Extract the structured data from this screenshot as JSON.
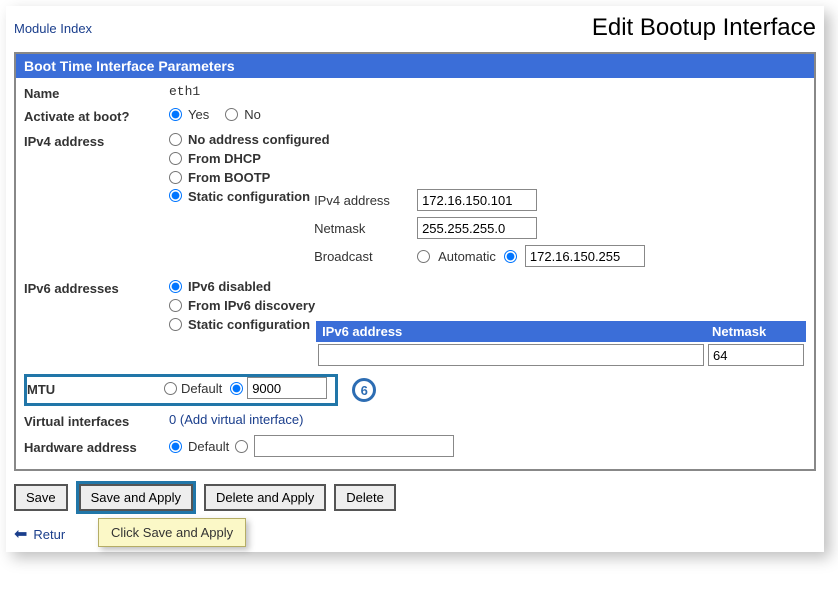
{
  "header": {
    "module_index_link": "Module Index",
    "page_title": "Edit Bootup Interface"
  },
  "panel": {
    "title": "Boot Time Interface Parameters",
    "name": {
      "label": "Name",
      "value": "eth1"
    },
    "activate": {
      "label": "Activate at boot?",
      "yes": "Yes",
      "no": "No"
    },
    "ipv4": {
      "label": "IPv4 address",
      "none": "No address configured",
      "dhcp": "From DHCP",
      "bootp": "From BOOTP",
      "static": "Static configuration",
      "addr_label": "IPv4 address",
      "addr_value": "172.16.150.101",
      "netmask_label": "Netmask",
      "netmask_value": "255.255.255.0",
      "broadcast_label": "Broadcast",
      "broadcast_auto": "Automatic",
      "broadcast_value": "172.16.150.255"
    },
    "ipv6": {
      "label": "IPv6 addresses",
      "disabled": "IPv6 disabled",
      "discovery": "From IPv6 discovery",
      "static": "Static configuration",
      "addr_header": "IPv6 address",
      "netmask_header": "Netmask",
      "addr_value": "",
      "netmask_value": "64"
    },
    "mtu": {
      "label": "MTU",
      "default": "Default",
      "value": "9000",
      "callout": "6"
    },
    "vifs": {
      "label": "Virtual interfaces",
      "count": "0",
      "add_link": "Add virtual interface"
    },
    "hw": {
      "label": "Hardware address",
      "default": "Default",
      "value": ""
    }
  },
  "buttons": {
    "save": "Save",
    "save_apply": "Save and Apply",
    "delete_apply": "Delete and Apply",
    "delete": "Delete"
  },
  "return_link": "Retur",
  "tooltip": "Click Save and Apply"
}
